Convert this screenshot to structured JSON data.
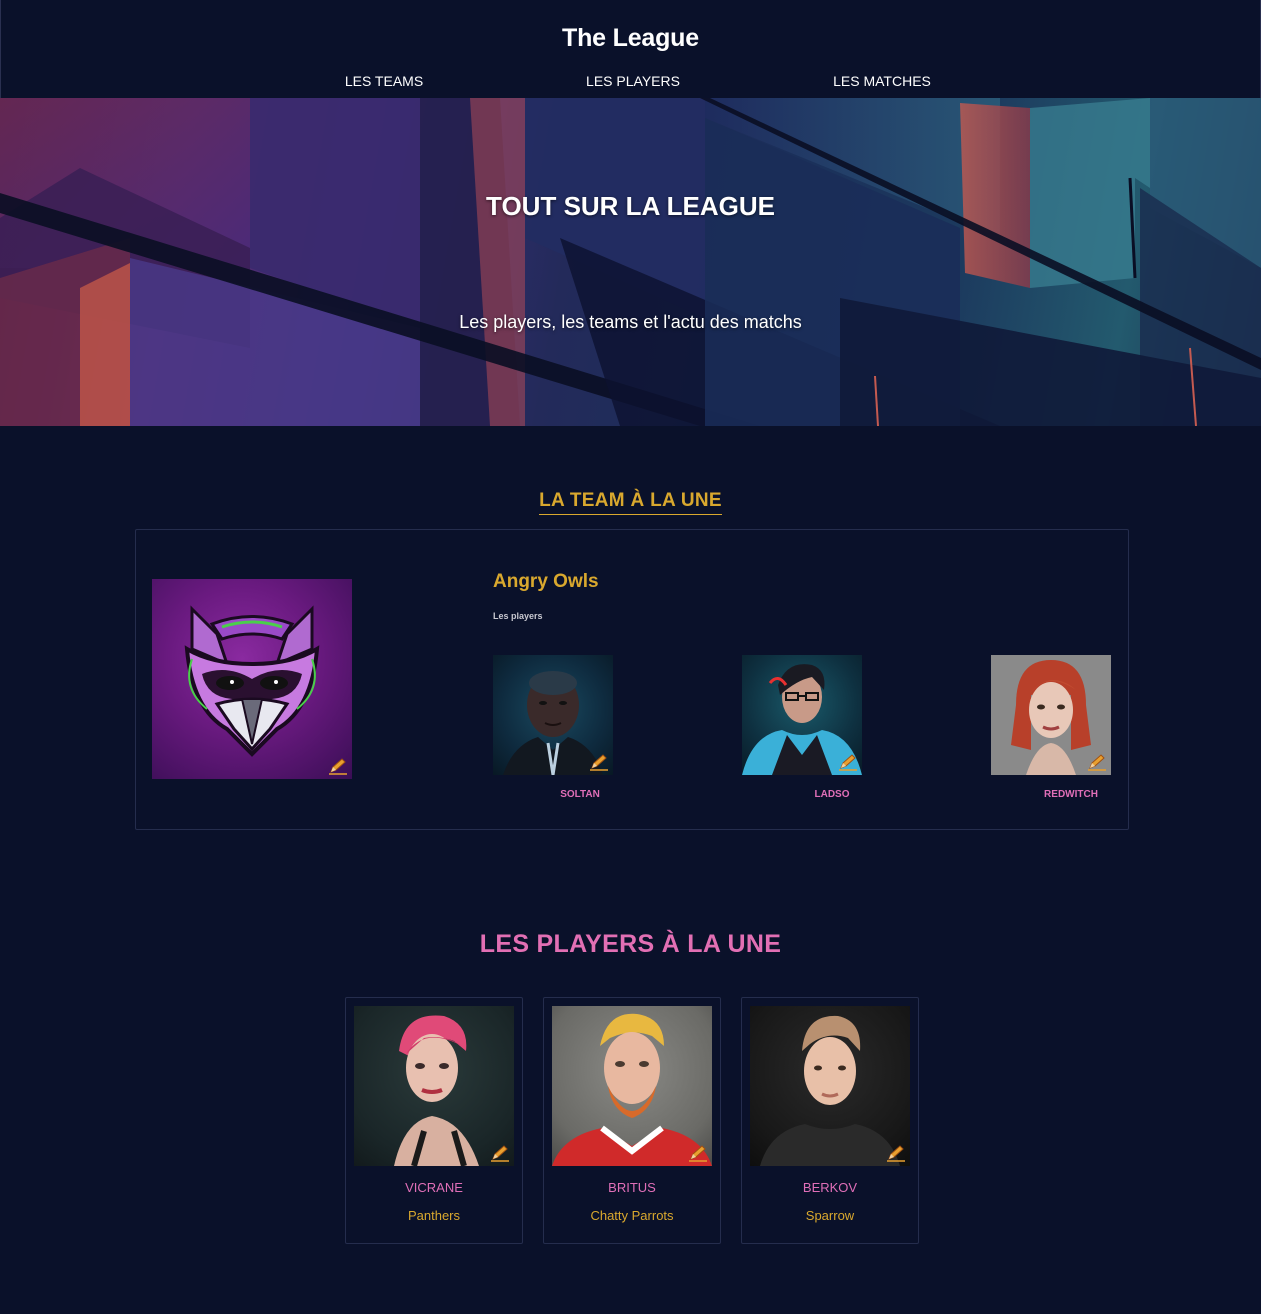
{
  "header": {
    "site_title": "The League",
    "nav": [
      {
        "label": "LES TEAMS"
      },
      {
        "label": "LES PLAYERS"
      },
      {
        "label": "LES MATCHES"
      }
    ]
  },
  "hero": {
    "title": "TOUT SUR LA LEAGUE",
    "subtitle": "Les players, les teams et l'actu des matchs"
  },
  "featured_team": {
    "section_title": "LA TEAM À LA UNE",
    "name": "Angry Owls",
    "players_label": "Les players",
    "players": [
      {
        "name": "SOLTAN"
      },
      {
        "name": "LADSO"
      },
      {
        "name": "REDWITCH"
      }
    ]
  },
  "featured_players": {
    "section_title": "LES PLAYERS À LA UNE",
    "players": [
      {
        "name": "VICRANE",
        "team": "Panthers"
      },
      {
        "name": "BRITUS",
        "team": "Chatty Parrots"
      },
      {
        "name": "BERKOV",
        "team": "Sparrow"
      }
    ]
  },
  "colors": {
    "background": "#0a112a",
    "accent_gold": "#d9a82e",
    "accent_pink": "#e06fb8"
  },
  "icons": {
    "edit": "pencil-icon"
  }
}
